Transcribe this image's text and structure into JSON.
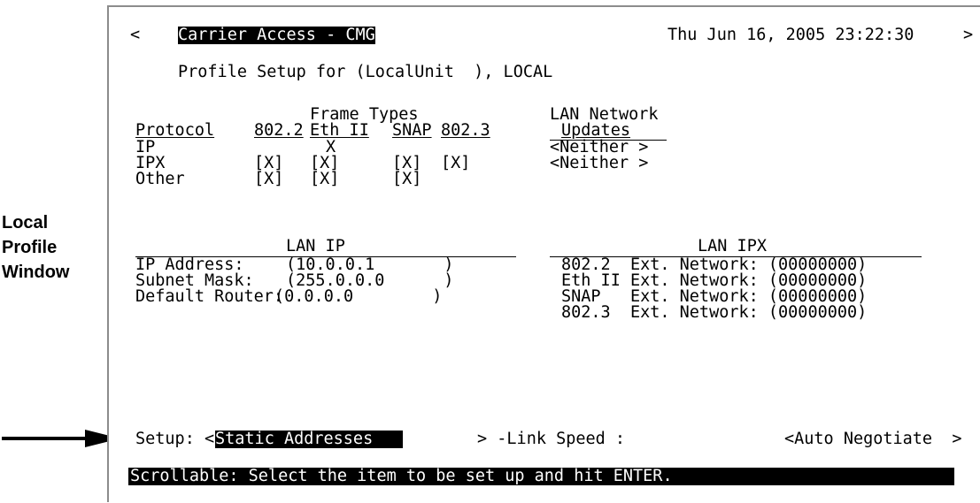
{
  "annotation": {
    "lines": [
      "Local",
      "Profile",
      "Window"
    ]
  },
  "header": {
    "left_caret": "<",
    "app_title": "Carrier Access - CMG",
    "datetime": "Thu Jun 16, 2005 23:22:30",
    "right_caret": ">"
  },
  "profile": {
    "title": "Profile Setup for (LocalUnit  ), LOCAL"
  },
  "frame_types": {
    "group_label": "Frame Types",
    "col_protocol": "Protocol",
    "col_8022": "802.2",
    "col_ethii": "Eth II",
    "col_snap": "SNAP",
    "col_8023": "802.3",
    "rows": [
      {
        "name": "IP",
        "c8022": "",
        "ethii": "X",
        "snap": "",
        "c8023": ""
      },
      {
        "name": "IPX",
        "c8022": "[X]",
        "ethii": "[X]",
        "snap": "[X]",
        "c8023": "[X]"
      },
      {
        "name": "Other",
        "c8022": "[X]",
        "ethii": "[X]",
        "snap": "[X]",
        "c8023": ""
      }
    ]
  },
  "lan_network": {
    "label": "LAN Network",
    "updates_label": "Updates",
    "values": [
      "<Neither >",
      "<Neither >"
    ]
  },
  "lan_ip": {
    "heading": "LAN IP",
    "rows": [
      {
        "label": "IP Address:",
        "value": "(10.0.0.1       )"
      },
      {
        "label": "Subnet Mask:",
        "value": "(255.0.0.0      )"
      },
      {
        "label": "Default Router:",
        "value": "(0.0.0.0        )"
      }
    ]
  },
  "lan_ipx": {
    "heading": "LAN IPX",
    "rows": [
      "802.2  Ext. Network: (00000000)",
      "Eth II Ext. Network: (00000000)",
      "SNAP   Ext. Network: (00000000)",
      "802.3  Ext. Network: (00000000)"
    ]
  },
  "setup": {
    "label": "Setup: <",
    "value": "Static Addresses   ",
    "close": "> -Link Speed :",
    "link_speed": "<Auto Negotiate  >"
  },
  "status": {
    "message": "Scrollable: Select the item to be set up and hit ENTER."
  }
}
